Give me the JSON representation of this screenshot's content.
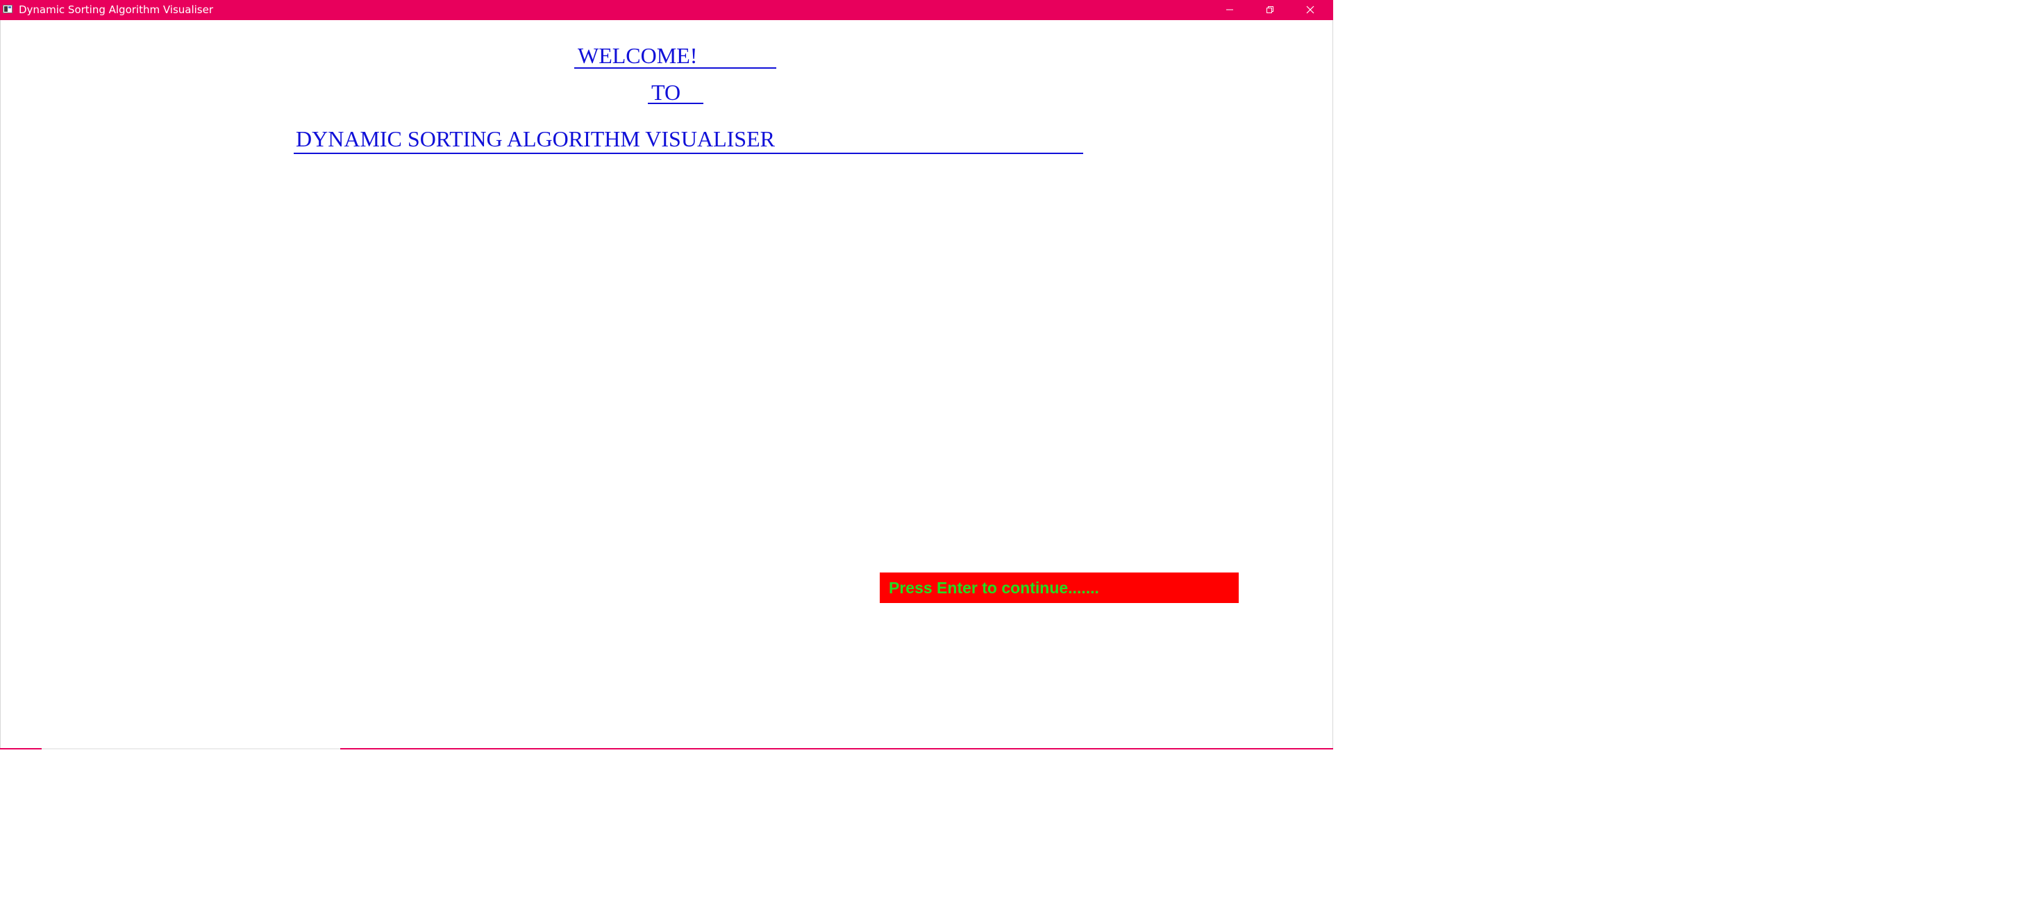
{
  "window": {
    "title": "Dynamic Sorting Algorithm Visualiser",
    "titlebar_color": "#e8005c",
    "icon": "app-window-icon",
    "controls": {
      "minimize_icon": "minimize-icon",
      "maximize_icon": "restore-icon",
      "close_icon": "close-icon"
    }
  },
  "welcome": {
    "line1": "WELCOME!",
    "line2": "TO",
    "line3": "DYNAMIC SORTING ALGORITHM VISUALISER",
    "text_color": "#1010d8"
  },
  "prompt": {
    "text": "Press Enter to continue.......",
    "background_color": "#ff0000",
    "text_color": "#22dd22"
  }
}
